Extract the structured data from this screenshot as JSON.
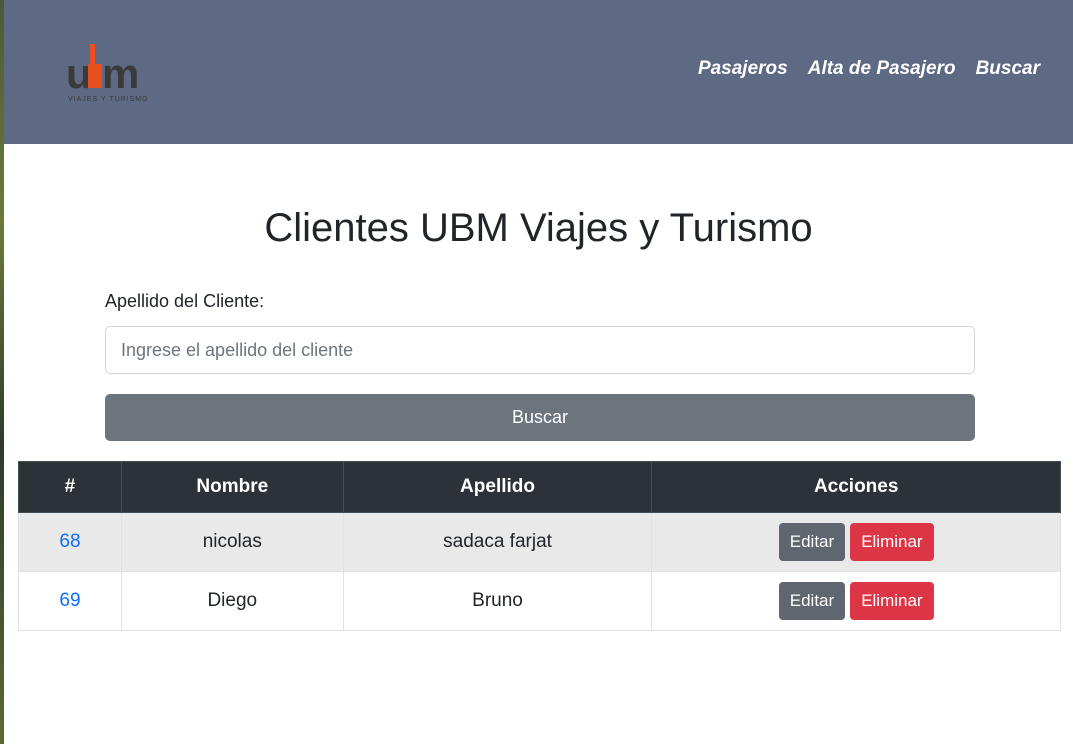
{
  "navbar": {
    "logo": {
      "text": "ubm",
      "subtext": "VIAJES Y TURISMO",
      "accent_color": "#e8501f"
    },
    "links": [
      "Pasajeros",
      "Alta de Pasajero",
      "Buscar"
    ],
    "background": "#5e6983"
  },
  "main": {
    "title": "Clientes UBM Viajes y Turismo",
    "search": {
      "label": "Apellido del Cliente:",
      "placeholder": "Ingrese el apellido del cliente",
      "value": "",
      "button_label": "Buscar"
    },
    "table": {
      "headers": [
        "#",
        "Nombre",
        "Apellido",
        "Acciones"
      ],
      "rows": [
        {
          "id": "68",
          "nombre": "nicolas",
          "apellido": "sadaca farjat",
          "edit_label": "Editar",
          "delete_label": "Eliminar"
        },
        {
          "id": "69",
          "nombre": "Diego",
          "apellido": "Bruno",
          "edit_label": "Editar",
          "delete_label": "Eliminar"
        }
      ]
    }
  },
  "colors": {
    "header_bg": "#2d3238",
    "secondary_btn": "#6c757d",
    "danger_btn": "#dc3545",
    "link": "#0d6efd"
  }
}
